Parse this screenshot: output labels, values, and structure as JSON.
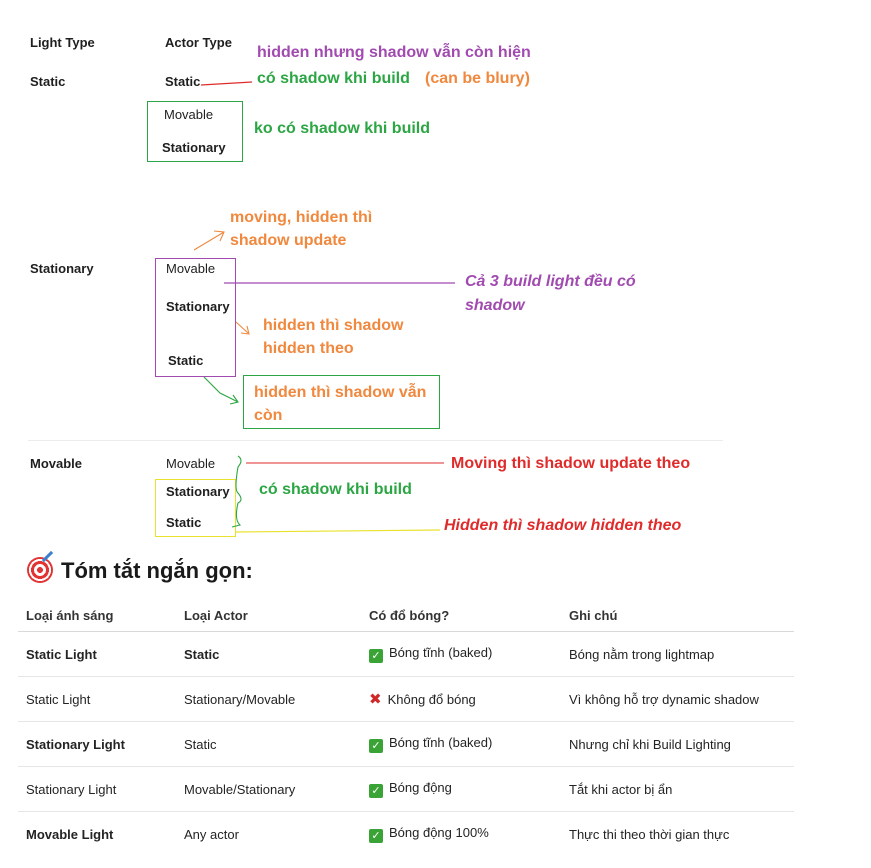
{
  "headers": {
    "light_type": "Light Type",
    "actor_type": "Actor Type"
  },
  "static_section": {
    "light": "Static",
    "actor_static": "Static",
    "actor_movable": "Movable",
    "actor_stationary": "Stationary",
    "note_hidden": "hidden nhưng shadow vẫn còn hiện",
    "note_build": "có shadow khi build",
    "note_blury": "(can be blury)",
    "note_no_shadow": "ko có shadow khi build"
  },
  "stationary_section": {
    "light": "Stationary",
    "actor_movable": "Movable",
    "actor_stationary": "Stationary",
    "actor_static": "Static",
    "note_moving_l1": "moving, hidden thì",
    "note_moving_l2": "shadow update",
    "note_all_l1": "Cả 3 build light đều có",
    "note_all_l2": "shadow",
    "note_hidden_l1": "hidden thì shadow",
    "note_hidden_l2": "hidden theo",
    "note_static_l1": "hidden thì shadow vẫn",
    "note_static_l2": "còn"
  },
  "movable_section": {
    "light": "Movable",
    "actor_movable": "Movable",
    "actor_stationary": "Stationary",
    "actor_static": "Static",
    "note_moving": "Moving thì shadow update theo",
    "note_build": "có shadow khi build",
    "note_hidden": "Hidden thì shadow hidden theo"
  },
  "summary": {
    "title": "Tóm tắt ngắn gọn:",
    "icon": "target-icon",
    "columns": [
      "Loại ánh sáng",
      "Loại Actor",
      "Có đổ bóng?",
      "Ghi chú"
    ],
    "rows": [
      {
        "light": "Static Light",
        "light_bold": true,
        "actor": "Static",
        "actor_bold": true,
        "shadow_icon": "check",
        "shadow": "Bóng tĩnh (baked)",
        "note": "Bóng nằm trong lightmap"
      },
      {
        "light": "Static Light",
        "light_bold": false,
        "actor": "Stationary/Movable",
        "actor_bold": false,
        "shadow_icon": "cross",
        "shadow": "Không đổ bóng",
        "note": "Vì không hỗ trợ dynamic shadow"
      },
      {
        "light": "Stationary Light",
        "light_bold": true,
        "actor": "Static",
        "actor_bold": false,
        "shadow_icon": "check",
        "shadow": "Bóng tĩnh (baked)",
        "note": "Nhưng chỉ khi Build Lighting"
      },
      {
        "light": "Stationary Light",
        "light_bold": false,
        "actor": "Movable/Stationary",
        "actor_bold": false,
        "shadow_icon": "check",
        "shadow": "Bóng động",
        "note": "Tắt khi actor bị ẩn"
      },
      {
        "light": "Movable Light",
        "light_bold": true,
        "actor": "Any actor",
        "actor_bold": false,
        "shadow_icon": "check",
        "shadow": "Bóng động 100%",
        "note": "Thực thi theo thời gian thực"
      }
    ]
  }
}
